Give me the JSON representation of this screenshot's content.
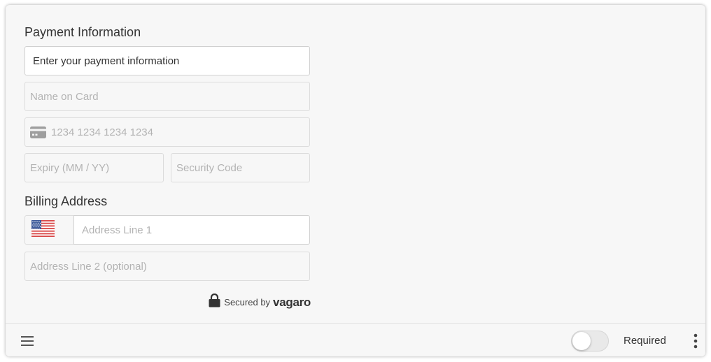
{
  "payment": {
    "title": "Payment Information",
    "summary_value": "Enter your payment information",
    "name_placeholder": "Name on Card",
    "card_placeholder": "1234 1234 1234 1234",
    "expiry_placeholder": "Expiry (MM / YY)",
    "security_placeholder": "Security Code"
  },
  "billing": {
    "title": "Billing Address",
    "country_icon": "us-flag-icon",
    "address1_placeholder": "Address Line 1",
    "address2_placeholder": "Address Line 2 (optional)"
  },
  "secured": {
    "by_text": "Secured by",
    "brand": "vagaro"
  },
  "footer": {
    "required_label": "Required",
    "required_toggle_on": false
  },
  "colors": {
    "card_background": "#f7f7f7",
    "text": "#333333",
    "placeholder": "#b3b3b3",
    "border": "#dcdcdc"
  }
}
